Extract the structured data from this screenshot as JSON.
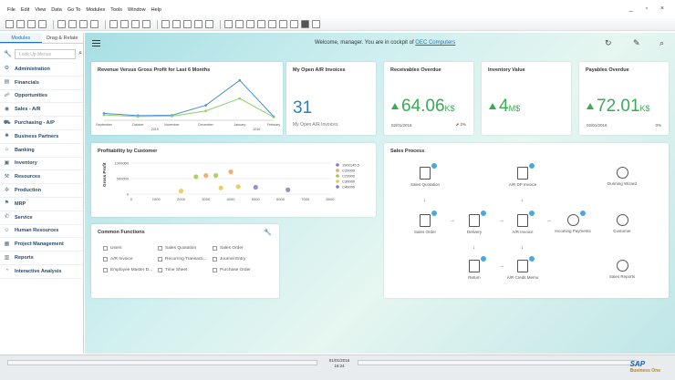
{
  "menu": [
    "File",
    "Edit",
    "View",
    "Data",
    "Go To",
    "Modules",
    "Tools",
    "Window",
    "Help"
  ],
  "window_controls": "_ ▫ ×",
  "sidebar": {
    "tabs": [
      "Modules",
      "Drag & Relate"
    ],
    "search_placeholder": "Look Up Menus",
    "modules": [
      "Administration",
      "Financials",
      "Opportunities",
      "Sales - A/R",
      "Purchasing - A/P",
      "Business Partners",
      "Banking",
      "Inventory",
      "Resources",
      "Production",
      "MRP",
      "Service",
      "Human Resources",
      "Project Management",
      "Reports",
      "Interactive Analysis"
    ]
  },
  "header": {
    "welcome_prefix": "Welcome, manager. You are in cockpit of",
    "company": "OEC Computers"
  },
  "cards": {
    "revenue": {
      "title": "Revenue Versus Gross Profit for Last 6 Months",
      "months": [
        "September",
        "October",
        "November",
        "December",
        "January",
        "February"
      ],
      "years": [
        "2015",
        "2016"
      ]
    },
    "open_ar": {
      "title": "My Open A/R Invoices",
      "value": "31",
      "label": "My Open A/R Invoices"
    },
    "receivables": {
      "title": "Receivables Overdue",
      "value": "64.06",
      "unit": "K$",
      "date": "02/01/2016",
      "pct": "2%"
    },
    "inventory": {
      "title": "Inventory Value",
      "value": "4",
      "unit": "M$"
    },
    "payables": {
      "title": "Payables Overdue",
      "value": "72.01",
      "unit": "K$",
      "date": "02/01/2016",
      "pct": "0%"
    },
    "profitability": {
      "title": "Profitability by Customer",
      "ylabel": "Gross Profit",
      "yticks": [
        "1000000",
        "500000",
        "0"
      ],
      "xticks": [
        "0",
        "1000",
        "2000",
        "3000",
        "4000",
        "5000",
        "6000",
        "7000",
        "8000"
      ],
      "legend": [
        "1902145.5",
        "C20000",
        "C23900",
        "C30000",
        "C40000"
      ]
    },
    "common_functions": {
      "title": "Common Functions",
      "items": [
        "Users",
        "Sales Quotation",
        "Sales Order",
        "A/R Invoice",
        "Recurring Transacti...",
        "Journal Entry",
        "Employee Master D...",
        "Time Sheet",
        "Purchase Order"
      ]
    },
    "sales_process": {
      "title": "Sales Process",
      "nodes": [
        "Sales Quotation",
        "A/R DP Invoice",
        "Dunning Wizard",
        "Sales Order",
        "Delivery",
        "A/R Invoice",
        "Incoming Payments",
        "Customer",
        "Return",
        "A/R Credit Memo",
        "Sales Reports"
      ]
    }
  },
  "status": {
    "date": "01/01/2016",
    "time": "16:24",
    "brand": "SAP",
    "brand_sub": "Business One"
  },
  "colors": {
    "accent": "#1d6fb8",
    "kpi_green": "#3aaa55",
    "revenue_line": "#4a8fd0",
    "profit_line": "#8ccf6a"
  },
  "chart_data": [
    {
      "type": "line",
      "title": "Revenue Versus Gross Profit for Last 6 Months",
      "categories": [
        "September",
        "October",
        "November",
        "December",
        "January",
        "February"
      ],
      "series": [
        {
          "values": [
            22,
            15,
            16,
            48,
            128,
            12
          ]
        },
        {
          "values": [
            17,
            12,
            13,
            30,
            70,
            10
          ]
        }
      ],
      "ylim": [
        0,
        140
      ]
    },
    {
      "type": "scatter",
      "title": "Profitability by Customer",
      "ylabel": "Gross Profit",
      "xlim": [
        0,
        8000
      ],
      "ylim": [
        0,
        1000000
      ],
      "series": [
        {
          "name": "C20000",
          "points": [
            [
              3000,
              600000
            ],
            [
              4000,
              720000
            ]
          ]
        },
        {
          "name": "C23900",
          "points": [
            [
              2600,
              560000
            ],
            [
              3400,
              600000
            ]
          ]
        },
        {
          "name": "C30000",
          "points": [
            [
              3600,
              200000
            ],
            [
              2000,
              100000
            ],
            [
              4300,
              240000
            ]
          ]
        },
        {
          "name": "C40000",
          "points": [
            [
              5000,
              220000
            ],
            [
              6300,
              140000
            ]
          ]
        }
      ]
    }
  ]
}
